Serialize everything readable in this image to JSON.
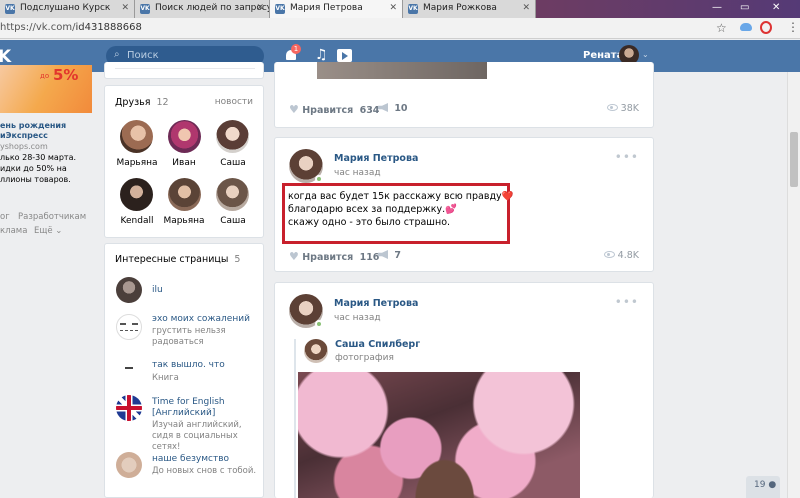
{
  "browser": {
    "tabs": [
      {
        "label": "Подслушано Курск"
      },
      {
        "label": "Поиск людей по запросу"
      },
      {
        "label": "Мария Петрова"
      },
      {
        "label": "Мария Рожкова"
      }
    ],
    "url": {
      "host": "https://vk.com/",
      "path": "id431888668"
    }
  },
  "header": {
    "search_placeholder": "Поиск",
    "notification_count": "1",
    "user_name": "Рената"
  },
  "left_ad": {
    "do_label": "до",
    "percent": "5%",
    "lines": [
      "ень рождения",
      "иЭкспресс",
      "yshops.com",
      "лько 28-30 марта.",
      "идки до 50% на",
      "ллионы товаров."
    ],
    "links": [
      "ог",
      "Разработчикам",
      "клама",
      "Ещё ⌄"
    ]
  },
  "friends": {
    "title": "Друзья",
    "count": "12",
    "news_link": "новости",
    "people": [
      {
        "name": "Марьяна"
      },
      {
        "name": "Иван"
      },
      {
        "name": "Саша"
      },
      {
        "name": "Kendall"
      },
      {
        "name": "Марьяна"
      },
      {
        "name": "Саша"
      }
    ]
  },
  "pages": {
    "title": "Интересные страницы",
    "count": "5",
    "items": [
      {
        "title": "ilu",
        "subtitle": ""
      },
      {
        "title": "эхо моих сожалений",
        "subtitle": "грустить нельзя радоваться"
      },
      {
        "title": "так вышло. что",
        "subtitle": "Книга"
      },
      {
        "title": "Time for English [Английский]",
        "subtitle": "Изучай английский, сидя в социальных сетях!"
      },
      {
        "title": "наше безумство",
        "subtitle": "До новых снов с тобой."
      }
    ]
  },
  "top_post": {
    "like_label": "Нравится",
    "likes": "634",
    "shares": "10",
    "views": "38K"
  },
  "post1": {
    "author": "Мария Петрова",
    "time": "час назад",
    "text_lines": [
      "когда вас будет 15к расскажу всю правду❤️",
      "благодарю всех за поддержку.💕",
      "скажу одно - это было страшно."
    ],
    "like_label": "Нравится",
    "likes": "116",
    "shares": "7",
    "views": "4.8K"
  },
  "post2": {
    "author": "Мария Петрова",
    "time": "час назад",
    "repost_author": "Саша Спилберг",
    "repost_sub": "фотография"
  },
  "chat_counter": "19"
}
